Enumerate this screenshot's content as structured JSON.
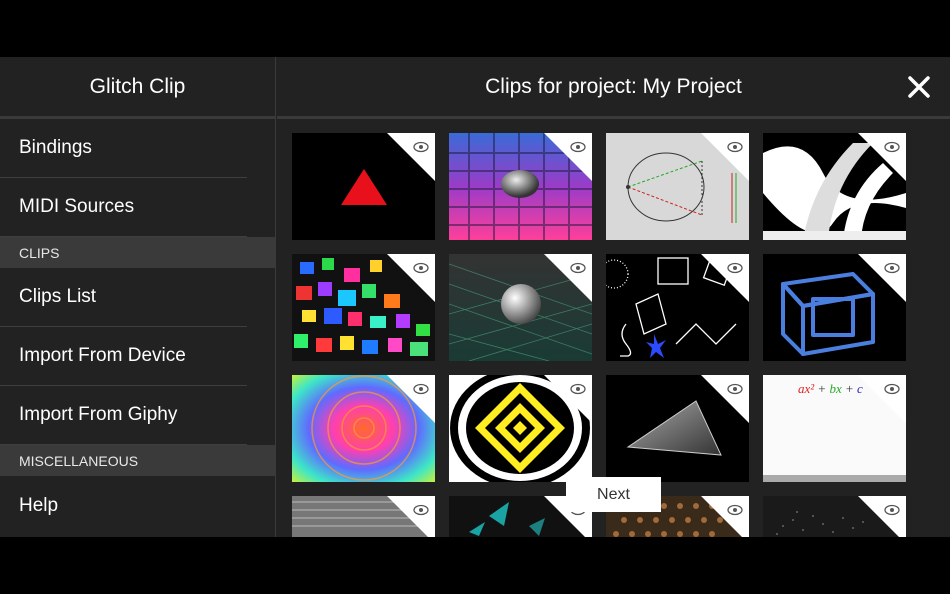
{
  "sidebar": {
    "title": "Glitch Clip",
    "items_top": [
      {
        "label": "Bindings"
      },
      {
        "label": "MIDI Sources"
      }
    ],
    "section_clips": "CLIPS",
    "items_clips": [
      {
        "label": "Clips List"
      },
      {
        "label": "Import From Device"
      },
      {
        "label": "Import From Giphy"
      }
    ],
    "section_misc": "MISCELLANEOUS",
    "items_misc": [
      {
        "label": "Help"
      }
    ]
  },
  "main": {
    "title": "Clips for project: My Project",
    "close_icon": "close-icon",
    "next_label": "Next",
    "clips": [
      {
        "name": "red-triangle-clip",
        "icon": "eye-icon"
      },
      {
        "name": "chrome-sphere-grid-clip",
        "icon": "eye-icon"
      },
      {
        "name": "ellipse-diagram-clip",
        "icon": "eye-icon"
      },
      {
        "name": "bw-swirl-clip",
        "icon": "eye-icon"
      },
      {
        "name": "colorful-cubes-clip",
        "icon": "eye-icon"
      },
      {
        "name": "silver-sphere-clip",
        "icon": "eye-icon"
      },
      {
        "name": "line-shapes-clip",
        "icon": "eye-icon"
      },
      {
        "name": "tesseract-clip",
        "icon": "eye-icon"
      },
      {
        "name": "psychedelic-tunnel-clip",
        "icon": "eye-icon"
      },
      {
        "name": "op-art-diamond-clip",
        "icon": "eye-icon"
      },
      {
        "name": "glass-triangle-clip",
        "icon": "eye-icon"
      },
      {
        "name": "equation-clip",
        "icon": "eye-icon",
        "text": "ax² + bx + c"
      },
      {
        "name": "grey-texture-clip",
        "icon": "eye-icon"
      },
      {
        "name": "teal-shards-clip",
        "icon": "eye-icon"
      },
      {
        "name": "brown-pattern-clip",
        "icon": "eye-icon"
      },
      {
        "name": "dark-particles-clip",
        "icon": "eye-icon"
      }
    ]
  }
}
